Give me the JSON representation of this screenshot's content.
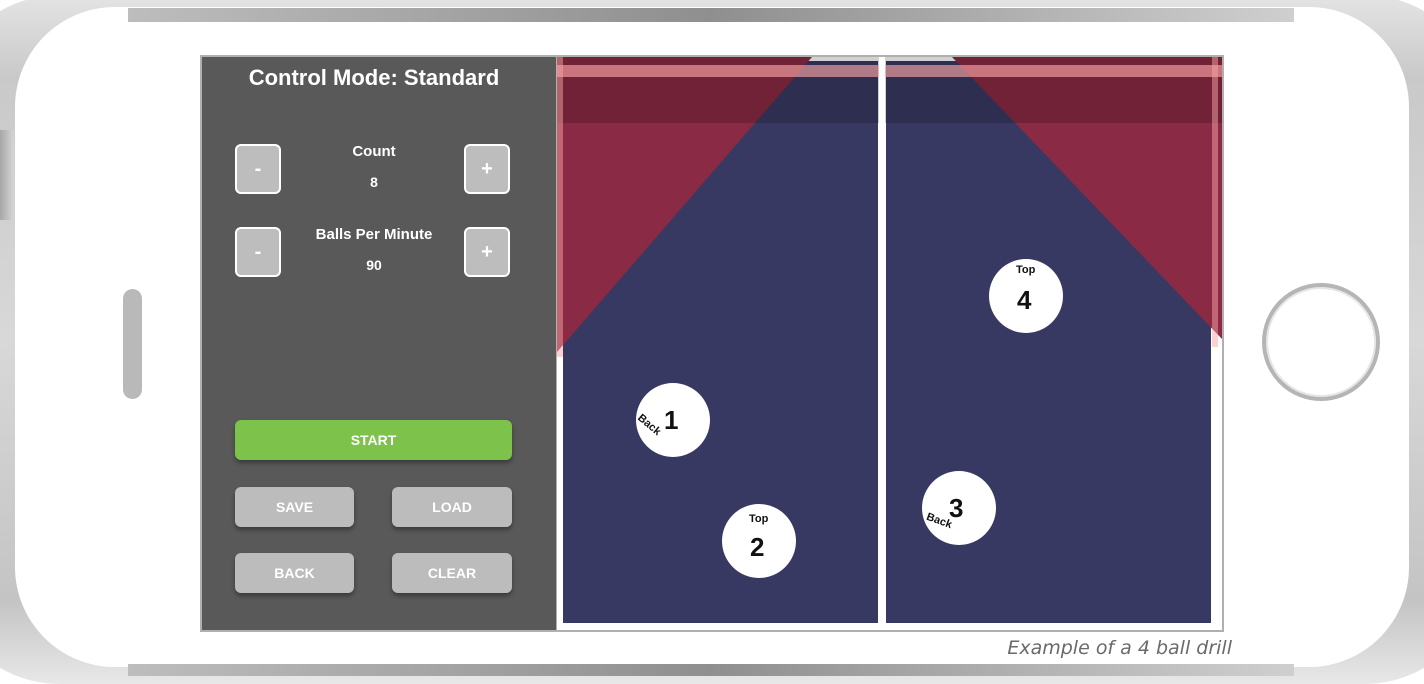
{
  "control_mode": "Control Mode: Standard",
  "count": {
    "label": "Count",
    "value": "8",
    "decrement_label": "-",
    "increment_label": "+"
  },
  "bpm": {
    "label": "Balls Per Minute",
    "value": "90",
    "decrement_label": "-",
    "increment_label": "+"
  },
  "buttons": {
    "start": "START",
    "save": "SAVE",
    "load": "LOAD",
    "back": "BACK",
    "clear": "CLEAR"
  },
  "balls": [
    {
      "number": "1",
      "spin": "Back"
    },
    {
      "number": "2",
      "spin": "Top"
    },
    {
      "number": "3",
      "spin": "Back"
    },
    {
      "number": "4",
      "spin": "Top"
    }
  ],
  "caption": "Example of a 4 ball drill",
  "colors": {
    "panel": "#595959",
    "start": "#7dc24b",
    "button_gray": "#bcbcbc",
    "table_blue": "#383962",
    "zone_red": "#8a2a44"
  }
}
